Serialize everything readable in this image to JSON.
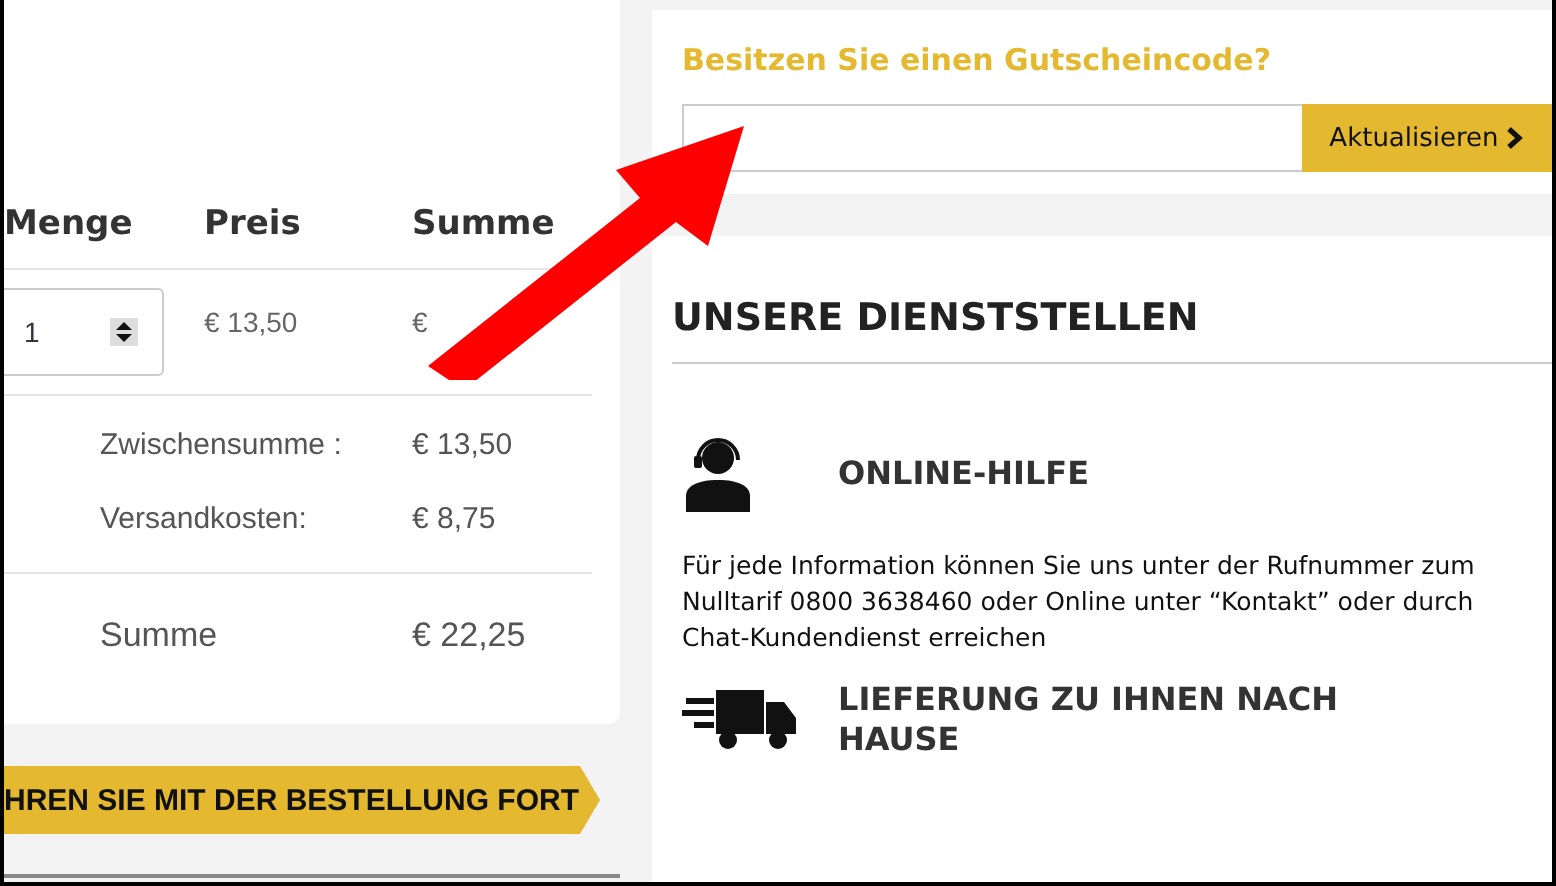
{
  "cart": {
    "columns": [
      "Menge",
      "Preis",
      "Summe"
    ],
    "rows": [
      {
        "quantity": "1",
        "price": "€ 13,50",
        "total": "€"
      }
    ],
    "summary": [
      {
        "kind": "subtotal",
        "label": "Zwischensumme :",
        "value": "€ 13,50"
      },
      {
        "kind": "subtotal",
        "label": "Versandkosten:",
        "value": "€ 8,75"
      },
      {
        "kind": "total",
        "label": "Summe",
        "value": "€ 22,25"
      }
    ],
    "checkout_button": "HREN SIE MIT DER BESTELLUNG FORT"
  },
  "coupon": {
    "title": "Besitzen Sie einen Gutscheincode?",
    "button": "Aktualisieren"
  },
  "services": {
    "title": "UNSERE DIENSTSTELLEN",
    "items": [
      {
        "kind": "headset",
        "title": "ONLINE-HILFE",
        "description": "Für jede Information können Sie uns unter der Rufnummer zum Nulltarif 0800 3638460 oder Online unter “Kontakt” oder durch Chat-Kundendienst erreichen"
      },
      {
        "kind": "truck",
        "title": "LIEFERUNG ZU IHNEN NACH HAUSE"
      }
    ]
  }
}
